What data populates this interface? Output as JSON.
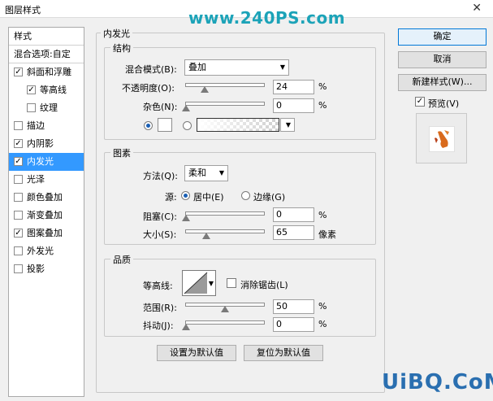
{
  "window": {
    "title": "图层样式",
    "watermark": "www.240PS.com",
    "close_glyph": "✕"
  },
  "style_list": {
    "header_styles": "样式",
    "header_blend": "混合选项:自定",
    "items": [
      {
        "label": "斜面和浮雕",
        "checked": true,
        "check": "✓",
        "indent": false,
        "selected": false
      },
      {
        "label": "等高线",
        "checked": true,
        "check": "✓",
        "indent": true,
        "selected": false
      },
      {
        "label": "纹理",
        "checked": false,
        "check": "",
        "indent": true,
        "selected": false
      },
      {
        "label": "描边",
        "checked": false,
        "check": "",
        "indent": false,
        "selected": false
      },
      {
        "label": "内阴影",
        "checked": true,
        "check": "✓",
        "indent": false,
        "selected": false
      },
      {
        "label": "内发光",
        "checked": true,
        "check": "✓",
        "indent": false,
        "selected": true
      },
      {
        "label": "光泽",
        "checked": false,
        "check": "",
        "indent": false,
        "selected": false
      },
      {
        "label": "颜色叠加",
        "checked": false,
        "check": "",
        "indent": false,
        "selected": false
      },
      {
        "label": "渐变叠加",
        "checked": false,
        "check": "",
        "indent": false,
        "selected": false
      },
      {
        "label": "图案叠加",
        "checked": true,
        "check": "✓",
        "indent": false,
        "selected": false
      },
      {
        "label": "外发光",
        "checked": false,
        "check": "",
        "indent": false,
        "selected": false
      },
      {
        "label": "投影",
        "checked": false,
        "check": "",
        "indent": false,
        "selected": false
      }
    ]
  },
  "inner_glow": {
    "section_title": "内发光",
    "structure": {
      "title": "结构",
      "blend_mode_label": "混合模式(B):",
      "blend_mode_value": "叠加",
      "opacity_label": "不透明度(O):",
      "opacity_value": "24",
      "opacity_unit": "%",
      "noise_label": "杂色(N):",
      "noise_value": "0",
      "noise_unit": "%"
    },
    "elements": {
      "title": "图素",
      "method_label": "方法(Q):",
      "method_value": "柔和",
      "source_label": "源:",
      "source_center": "居中(E)",
      "source_edge": "边缘(G)",
      "choke_label": "阻塞(C):",
      "choke_value": "0",
      "choke_unit": "%",
      "size_label": "大小(S):",
      "size_value": "65",
      "size_unit": "像素"
    },
    "quality": {
      "title": "品质",
      "contour_label": "等高线:",
      "anti_alias_label": "消除锯齿(L)",
      "range_label": "范围(R):",
      "range_value": "50",
      "range_unit": "%",
      "jitter_label": "抖动(J):",
      "jitter_value": "0",
      "jitter_unit": "%"
    },
    "make_default": "设置为默认值",
    "reset_default": "复位为默认值"
  },
  "right_panel": {
    "ok": "确定",
    "cancel": "取消",
    "new_style": "新建样式(W)...",
    "preview_label": "预览(V)",
    "preview_check": "✓"
  },
  "footer_watermark": "UiBQ.CoM",
  "colors": {
    "selected": "#3399ff",
    "watermark": "#1ca3b8"
  }
}
